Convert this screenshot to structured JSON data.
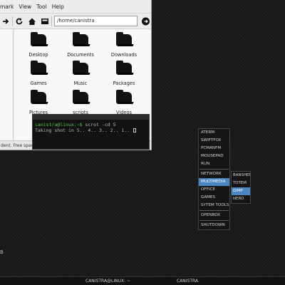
{
  "file_manager": {
    "menu": [
      "mark",
      "View",
      "Tool",
      "Help"
    ],
    "path": "/home/canistra",
    "folders": [
      "Desktop",
      "Documents",
      "Downloads",
      "Games",
      "Music",
      "Packages",
      "Pictures",
      "scripts",
      "Videos"
    ],
    "status": "den), Free space: "
  },
  "terminal": {
    "prompt_user": "canistra@linux:~$",
    "command": " scrot -cd 5",
    "output": "Taking shot in 5.. 4.. 3.. 2.. 1.. "
  },
  "root_menu": {
    "items": [
      "ATERM",
      "SWIFTFOX",
      "PCMANFM",
      "MOUSEPAD",
      "RUN",
      "NETWORK",
      "MULTIMEDIA",
      "OFFICE",
      "GAMES",
      "SYTEM TOOLS",
      "OPENBOX",
      "SHUTDOWN"
    ],
    "active": "MULTIMEDIA"
  },
  "multimedia_submenu": {
    "items": [
      "BANSHEE",
      "TOTEM",
      "GIMP",
      "NERO"
    ],
    "active": "GIMP"
  },
  "panel": {
    "task_terminal": "CANISTRA@LINUX: ~",
    "task_files": "CANISTRA"
  },
  "desktop_mark": "B",
  "colors": {
    "accent": "#4a86c0",
    "prompt": "#57c84a",
    "desktop": "#1b1b1b"
  },
  "icons": [
    "forward-icon",
    "reload-icon",
    "home-icon",
    "drive-icon",
    "go-icon",
    "folder-icon"
  ]
}
